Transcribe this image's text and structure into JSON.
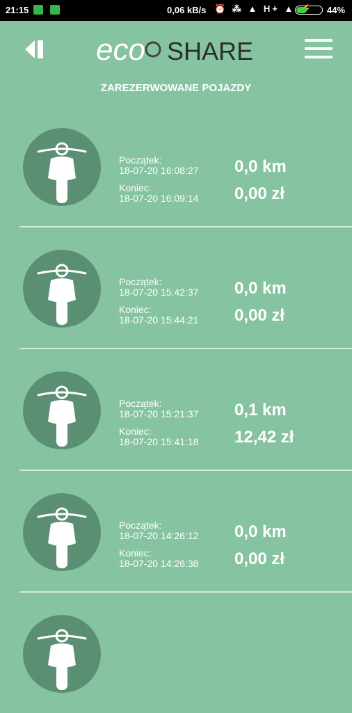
{
  "status_bar": {
    "time": "21:15",
    "net_speed": "0,06 kB/s",
    "network_type": "H+",
    "battery": "44%",
    "battery_level": 0.44
  },
  "header": {
    "logo_text": "ecoSHARE",
    "logo_left": "eco",
    "logo_right": "SHARE"
  },
  "page_title": "ZAREZERWOWANE POJAZDY",
  "labels": {
    "start": "Początek:",
    "end": "Koniec:"
  },
  "reservations": [
    {
      "start": "18-07-20 16:08:27",
      "end": "18-07-20 16:09:14",
      "distance": "0,0 km",
      "price": "0,00 zł"
    },
    {
      "start": "18-07-20 15:42:37",
      "end": "18-07-20 15:44:21",
      "distance": "0,0 km",
      "price": "0,00 zł"
    },
    {
      "start": "18-07-20 15:21:37",
      "end": "18-07-20 15:41:18",
      "distance": "0,1 km",
      "price": "12,42 zł"
    },
    {
      "start": "18-07-20 14:26:12",
      "end": "18-07-20 14:26:38",
      "distance": "0,0 km",
      "price": "0,00 zł"
    }
  ]
}
